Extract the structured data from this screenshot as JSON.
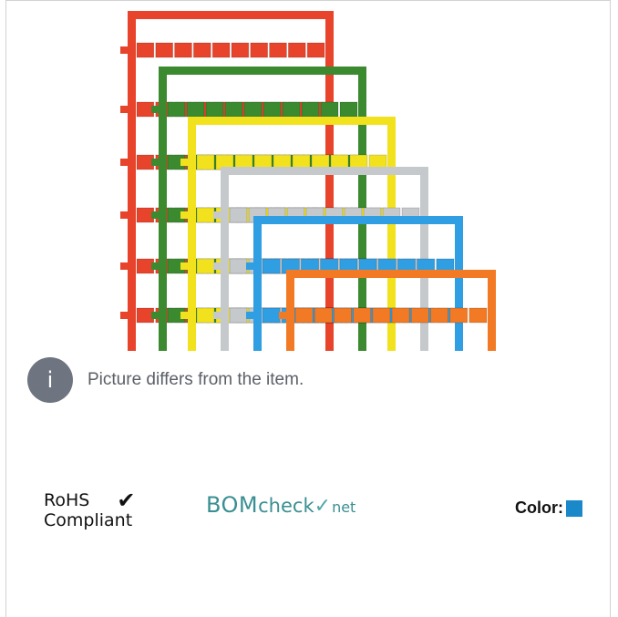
{
  "notice": {
    "icon_glyph": "i",
    "text": "Picture differs from the item."
  },
  "rohs": {
    "line1": "RoHS",
    "check": "✔",
    "line2": "Compliant"
  },
  "bomcheck": {
    "bom": "BOM",
    "check": "check",
    "v": "✓",
    "net": "net"
  },
  "color": {
    "label": "Color:",
    "swatch": "#1a88c9"
  },
  "image": {
    "frame_colors": [
      "#e8432b",
      "#3b8a2f",
      "#f2e21e",
      "#c6c9cc",
      "#2f9ee3",
      "#f27a24"
    ]
  }
}
